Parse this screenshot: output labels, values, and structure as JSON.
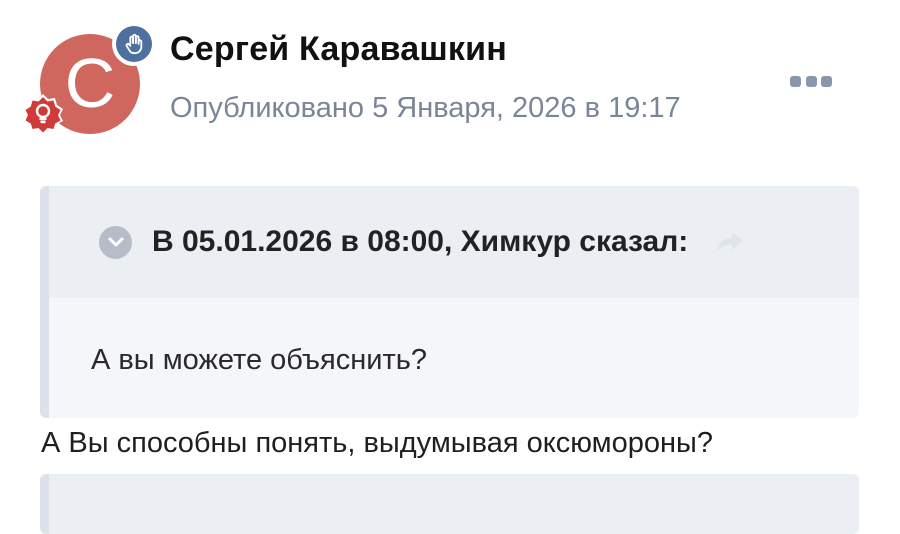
{
  "post": {
    "author_name": "Сергей Каравашкин",
    "published": "Опубликовано 5 Января, 2026 в 19:17",
    "avatar_letter": "C",
    "avatar_color": "#cf675f",
    "avatar_badge_icon": "raised-hand-icon",
    "rank_badge_icon": "lightbulb-icon",
    "more_icon": "more-dots-icon"
  },
  "quote": {
    "citation": "В 05.01.2026 в 08:00, Химкур сказал:",
    "text": "А вы можете объяснить?",
    "expand_icon": "chevron-down-icon",
    "share_icon": "share-arrow-icon"
  },
  "reply": {
    "text": "А Вы способны понять, выдумывая оксюмороны?"
  }
}
